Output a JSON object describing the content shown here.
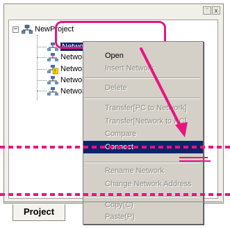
{
  "pane": {
    "toolbar": [
      {
        "icon": "dock-icon",
        "glyph": "¨"
      },
      {
        "icon": "close-icon",
        "glyph": "x"
      }
    ]
  },
  "tree": {
    "root_label": "NewProject",
    "selected_label": "Network1(DeviceNet)[#001]",
    "children": [
      "Network",
      "Network",
      "Network",
      "Network"
    ]
  },
  "context_menu": {
    "items": [
      {
        "label": "Open",
        "state": "normal"
      },
      {
        "label": "Insert Network",
        "state": "disabled"
      },
      {
        "label": "Delete",
        "state": "disabled"
      },
      {
        "label": "Transfer[PC to Network]",
        "state": "disabled"
      },
      {
        "label": "Transfer[Network to PC]",
        "state": "disabled"
      },
      {
        "label": "Compare",
        "state": "disabled"
      },
      {
        "label": "Connect",
        "state": "highlighted"
      },
      {
        "label": "Rename Network",
        "state": "disabled"
      },
      {
        "label": "Change Network Address",
        "state": "disabled"
      },
      {
        "label": "Copy(C)",
        "state": "disabled"
      },
      {
        "label": "Paste(P)",
        "state": "disabled"
      }
    ]
  },
  "tabs": {
    "active": "Project"
  },
  "colors": {
    "annotation": "#e8157f",
    "selection": "#0a246a",
    "menu_bg": "#d4d0c8"
  }
}
